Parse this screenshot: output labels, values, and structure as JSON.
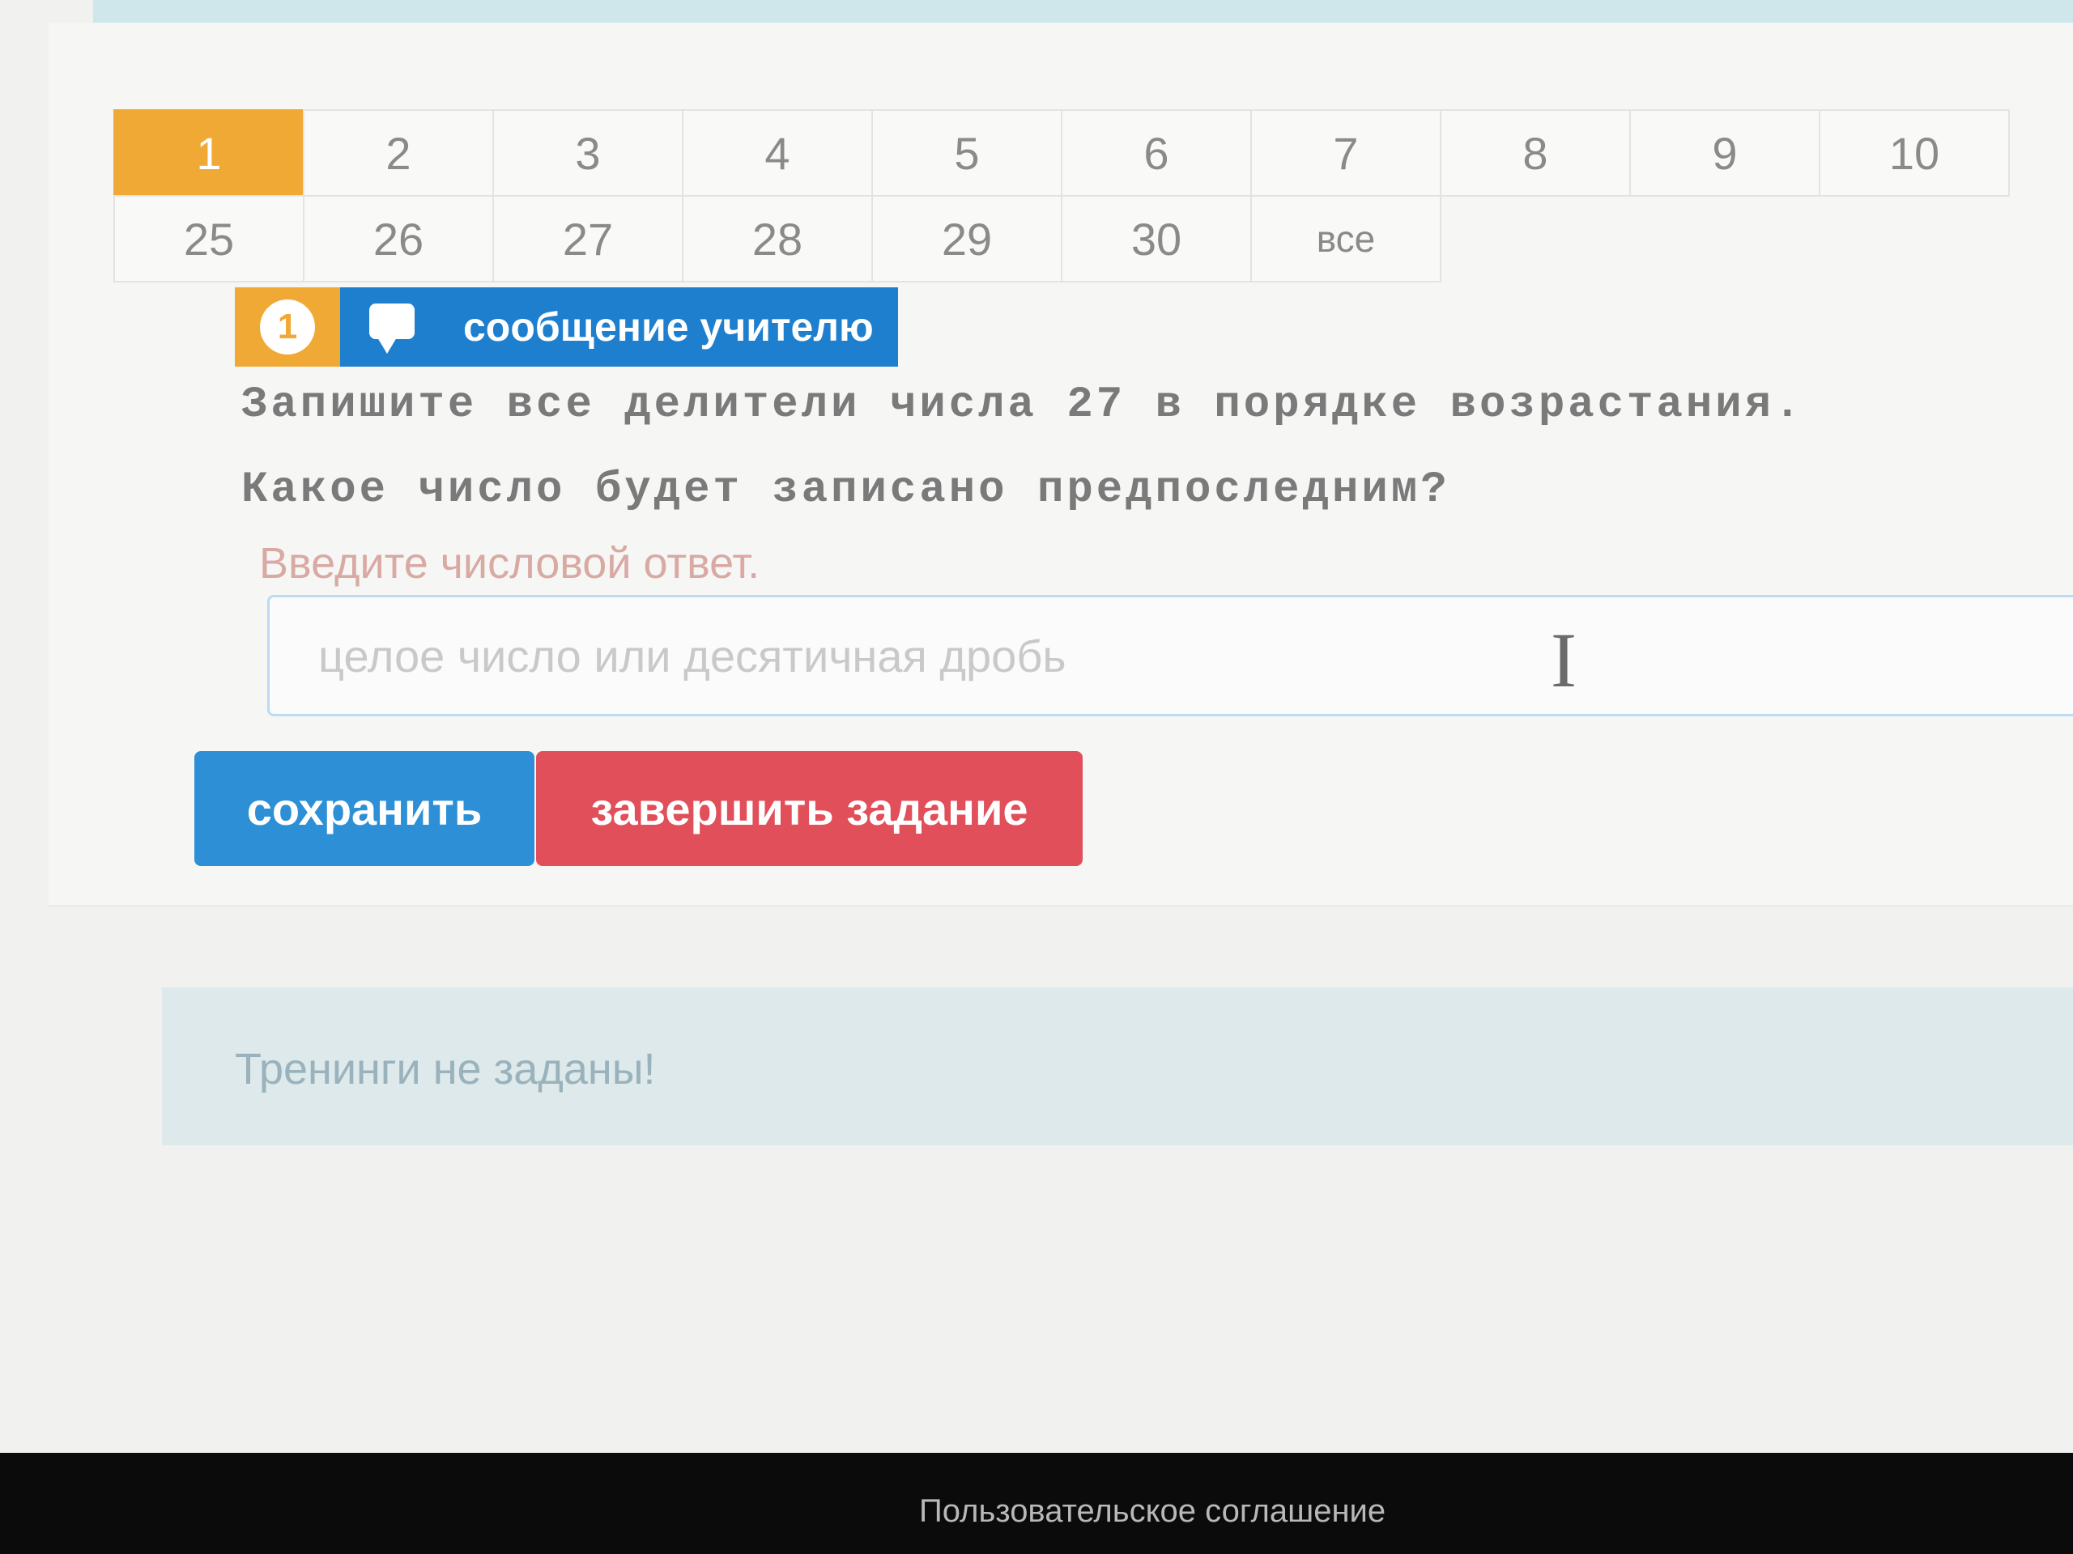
{
  "pager": {
    "row1": [
      "1",
      "2",
      "3",
      "4",
      "5",
      "6",
      "7",
      "8",
      "9",
      "10"
    ],
    "row2": [
      "25",
      "26",
      "27",
      "28",
      "29",
      "30",
      "все"
    ],
    "active": "1"
  },
  "task": {
    "number": "1",
    "message_teacher_label": "сообщение учителю",
    "question_line1": "Запишите все делители числа 27 в порядке возрастания.",
    "question_line2": "Какое число будет записано предпоследним?",
    "answer_label": "Введите числовой ответ.",
    "answer_value": "",
    "answer_placeholder": "целое число или десятичная дробь"
  },
  "actions": {
    "save_label": "сохранить",
    "finish_label": "завершить задание"
  },
  "trainings": {
    "text": "Тренинги не заданы!"
  },
  "footer": {
    "user_agreement": "Пользовательское соглашение"
  },
  "icons": {
    "message": "chat-bubble-icon",
    "cursor": "text-cursor-icon"
  },
  "colors": {
    "active_tab": "#f0a934",
    "primary": "#1f7fcf",
    "danger": "#e14f5a"
  }
}
